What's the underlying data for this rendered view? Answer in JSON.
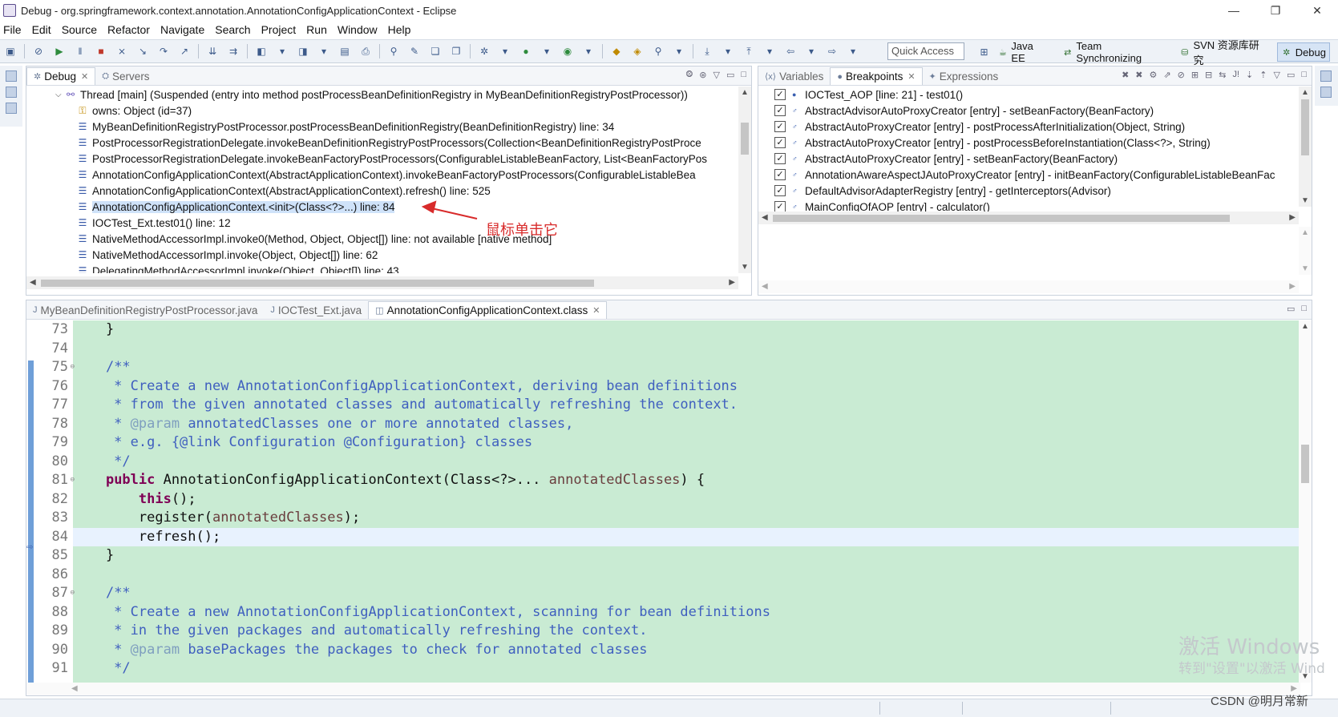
{
  "window": {
    "title": "Debug - org.springframework.context.annotation.AnnotationConfigApplicationContext - Eclipse",
    "controls": [
      "—",
      "❐",
      "✕"
    ]
  },
  "menu": [
    "File",
    "Edit",
    "Source",
    "Refactor",
    "Navigate",
    "Search",
    "Project",
    "Run",
    "Window",
    "Help"
  ],
  "toolbar": {
    "quick_access": "Quick Access",
    "perspectives": [
      {
        "label": "Java EE",
        "active": false
      },
      {
        "label": "Team Synchronizing",
        "active": false
      },
      {
        "label": "SVN 资源库研究",
        "active": false
      },
      {
        "label": "Debug",
        "active": true
      }
    ]
  },
  "debug_view": {
    "tabs": [
      {
        "label": "Debug",
        "active": true
      },
      {
        "label": "Servers",
        "active": false
      }
    ],
    "thread": "Thread [main] (Suspended (entry into method postProcessBeanDefinitionRegistry in MyBeanDefinitionRegistryPostProcessor))",
    "variable": "owns: Object  (id=37)",
    "frames": [
      "MyBeanDefinitionRegistryPostProcessor.postProcessBeanDefinitionRegistry(BeanDefinitionRegistry) line: 34",
      "PostProcessorRegistrationDelegate.invokeBeanDefinitionRegistryPostProcessors(Collection<BeanDefinitionRegistryPostProce",
      "PostProcessorRegistrationDelegate.invokeBeanFactoryPostProcessors(ConfigurableListableBeanFactory, List<BeanFactoryPos",
      "AnnotationConfigApplicationContext(AbstractApplicationContext).invokeBeanFactoryPostProcessors(ConfigurableListableBea",
      "AnnotationConfigApplicationContext(AbstractApplicationContext).refresh() line: 525",
      "AnnotationConfigApplicationContext.<init>(Class<?>...) line: 84",
      "IOCTest_Ext.test01() line: 12",
      "NativeMethodAccessorImpl.invoke0(Method, Object, Object[]) line: not available [native method]",
      "NativeMethodAccessorImpl.invoke(Object, Object[]) line: 62",
      "DelegatingMethodAccessorImpl.invoke(Object, Object[]) line: 43"
    ],
    "selected_index": 5,
    "annotation": "鼠标单击它"
  },
  "breakpoints_view": {
    "tabs": [
      {
        "label": "Variables",
        "active": false
      },
      {
        "label": "Breakpoints",
        "active": true
      },
      {
        "label": "Expressions",
        "active": false
      }
    ],
    "items": [
      "IOCTest_AOP [line: 21] - test01()",
      "AbstractAdvisorAutoProxyCreator [entry] - setBeanFactory(BeanFactory)",
      "AbstractAutoProxyCreator [entry] - postProcessAfterInitialization(Object, String)",
      "AbstractAutoProxyCreator [entry] - postProcessBeforeInstantiation(Class<?>, String)",
      "AbstractAutoProxyCreator [entry] - setBeanFactory(BeanFactory)",
      "AnnotationAwareAspectJAutoProxyCreator [entry] - initBeanFactory(ConfigurableListableBeanFac",
      "DefaultAdvisorAdapterRegistry [entry] - getInterceptors(Advisor)",
      "MainConfigOfAOP [entry] - calculator()"
    ]
  },
  "editor": {
    "tabs": [
      {
        "label": "MyBeanDefinitionRegistryPostProcessor.java",
        "active": false
      },
      {
        "label": "IOCTest_Ext.java",
        "active": false
      },
      {
        "label": "AnnotationConfigApplicationContext.class",
        "active": true
      }
    ],
    "line_numbers": [
      "73",
      "74",
      "75",
      "76",
      "77",
      "78",
      "79",
      "80",
      "81",
      "82",
      "83",
      "84",
      "85",
      "86",
      "87",
      "88",
      "89",
      "90",
      "91"
    ],
    "current_line": "84"
  },
  "watermark": {
    "line1": "激活 Windows",
    "line2": "转到\"设置\"以激活 Wind"
  },
  "credit": "CSDN @明月常新"
}
